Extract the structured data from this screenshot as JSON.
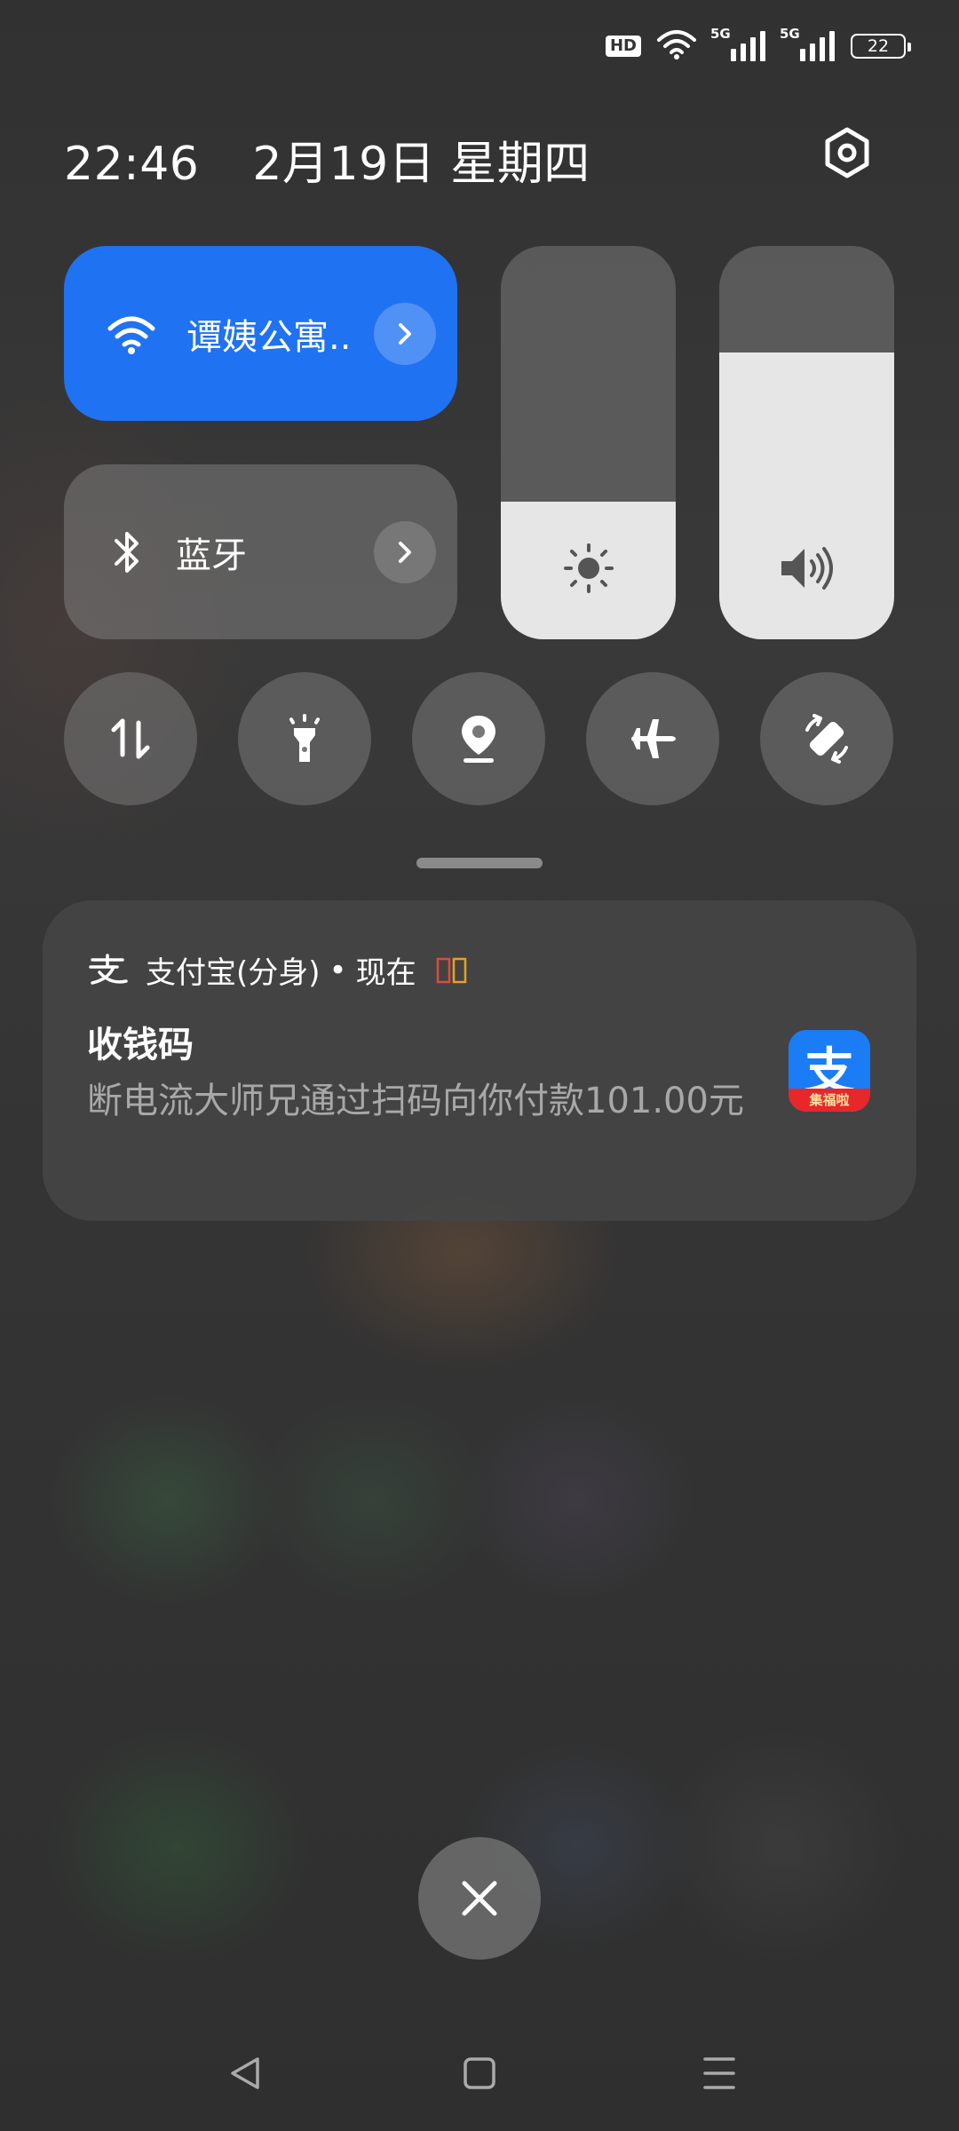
{
  "status_bar": {
    "hd_badge": "HD",
    "signal_1_label": "5G",
    "signal_2_label": "5G",
    "battery_level": "22"
  },
  "header": {
    "time": "22:46",
    "date": "2月19日 星期四"
  },
  "quick_settings": {
    "wifi_label": "谭姨公寓..",
    "bluetooth_label": "蓝牙",
    "brightness_level": 0.35,
    "volume_level": 0.73,
    "colors": {
      "wifi_tile": "#1f72f2"
    }
  },
  "notification": {
    "app_name": "支付宝(分身)",
    "separator": "•",
    "time": "现在",
    "title": "收钱码",
    "body": "断电流大师兄通过扫码向你付款101.00元",
    "icon_glyph": "支",
    "icon_ribbon": "集福啦"
  }
}
